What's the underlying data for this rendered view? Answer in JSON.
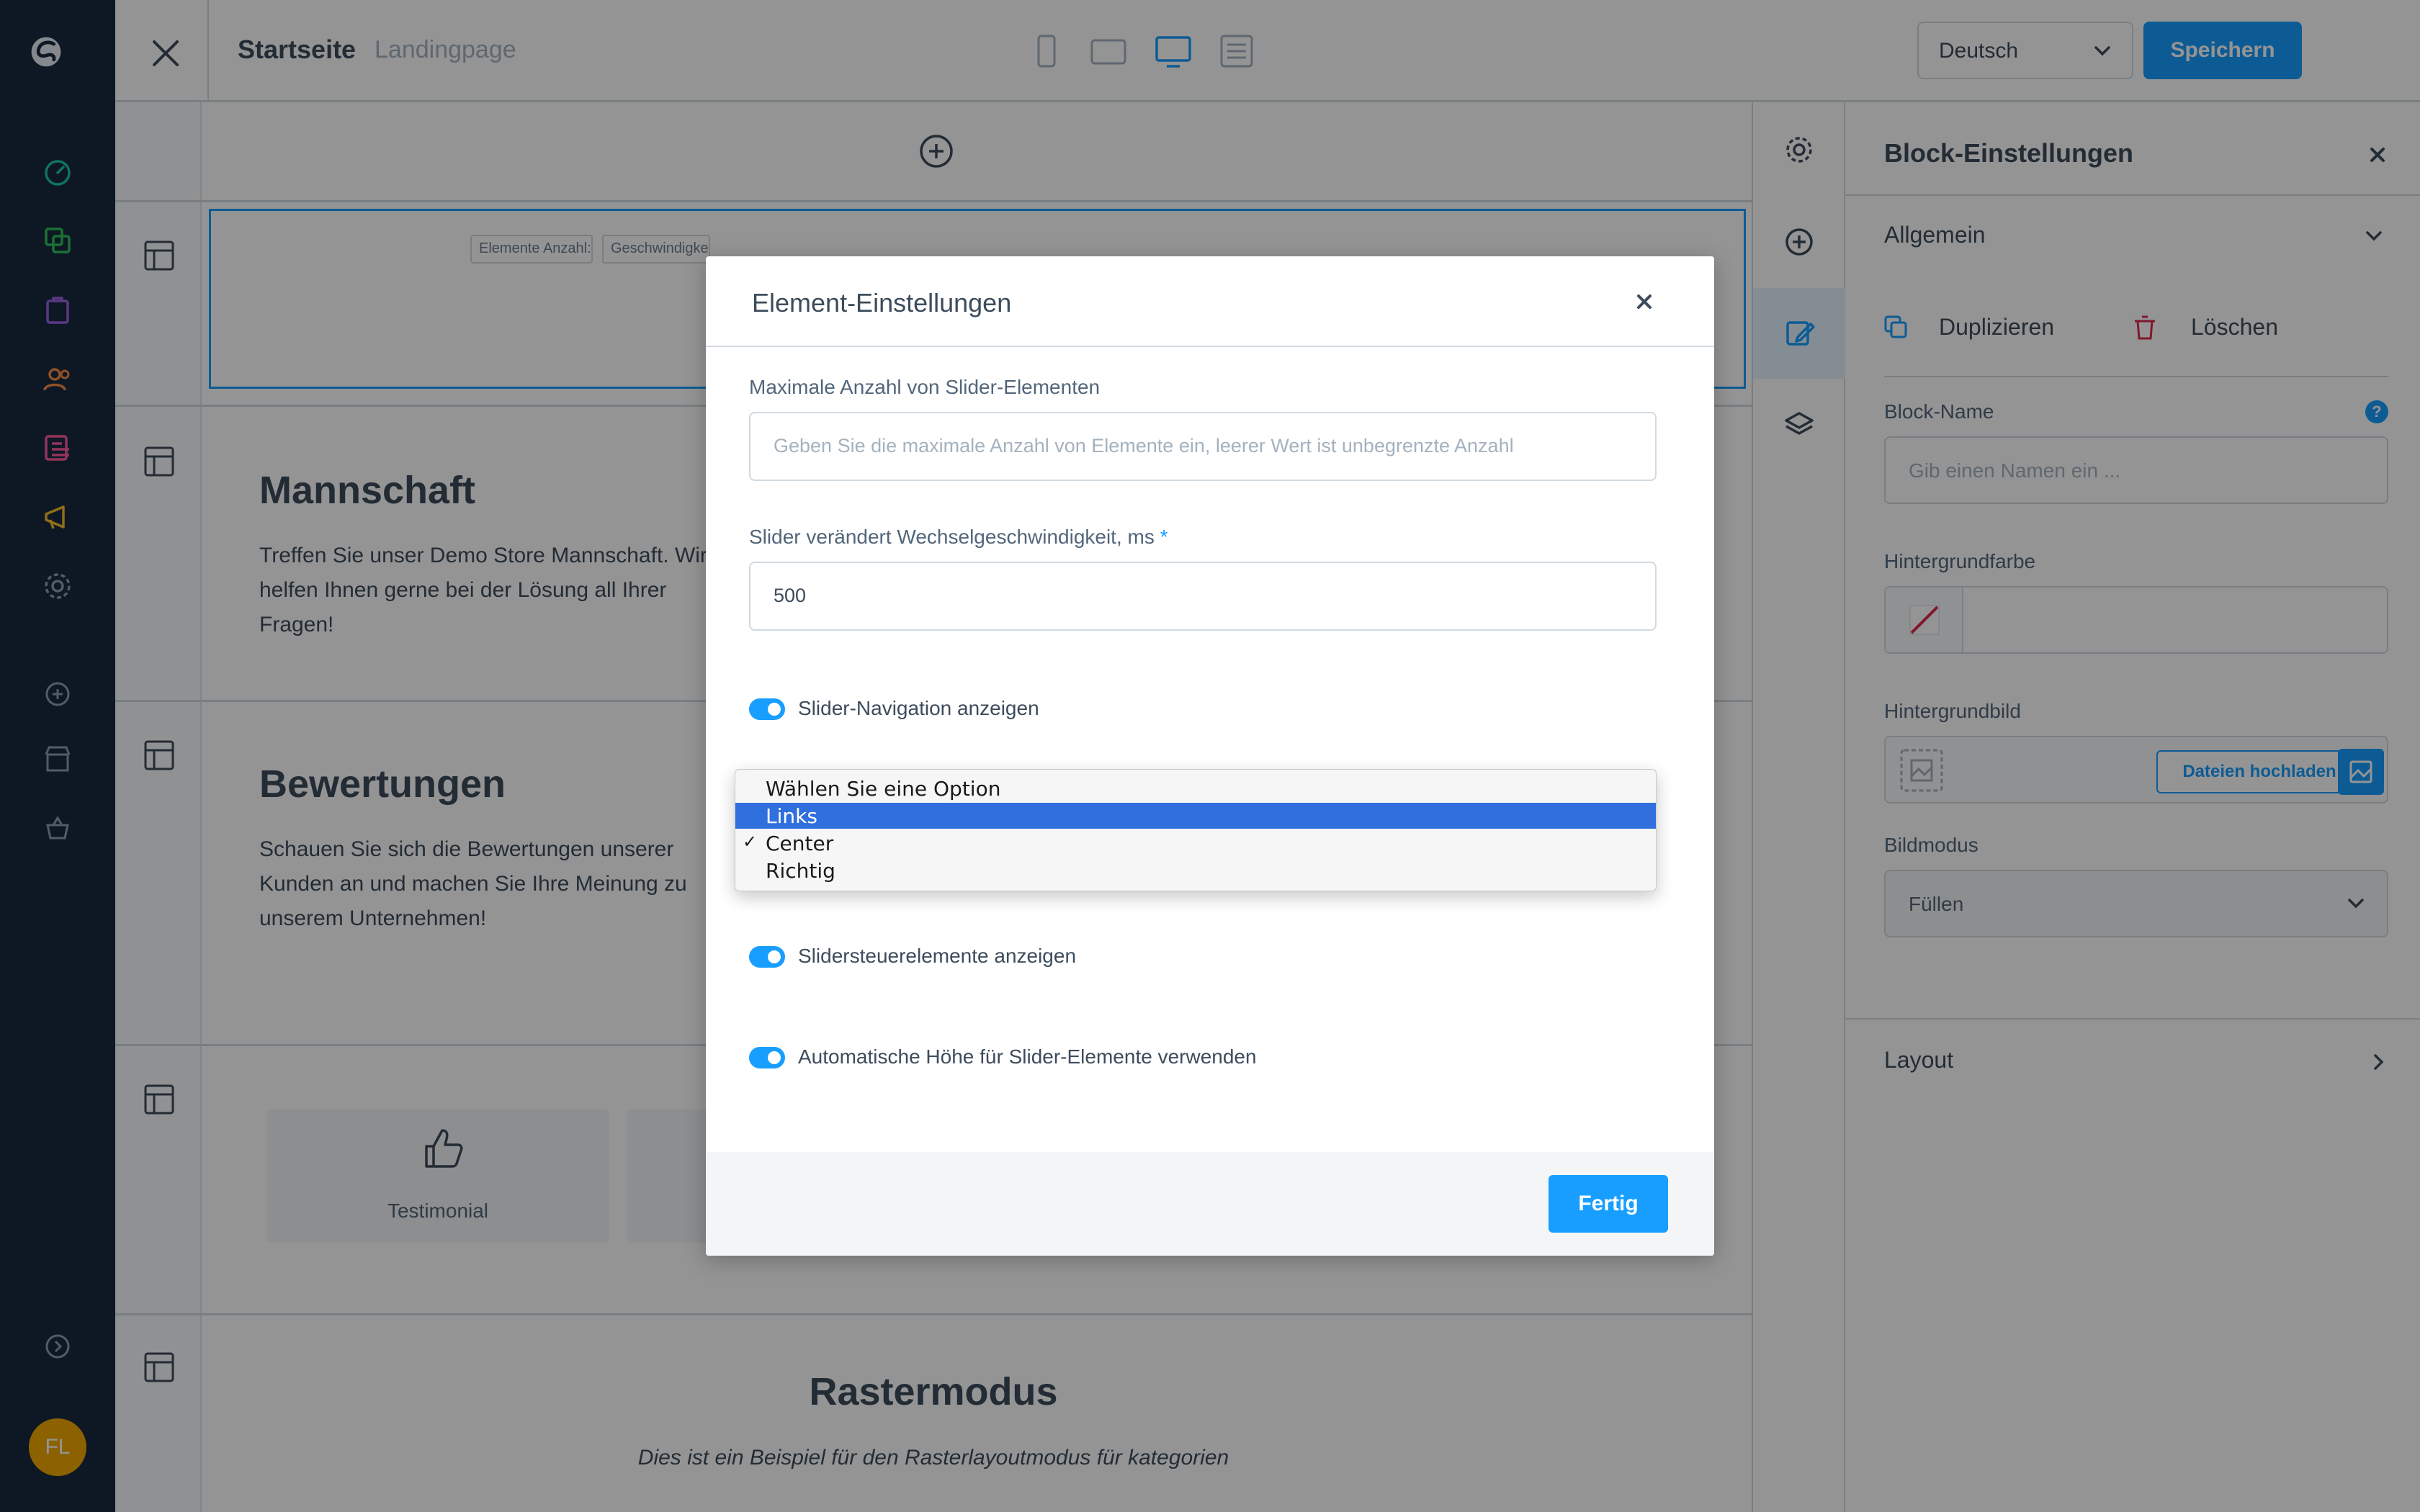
{
  "topbar": {
    "title": "Startseite",
    "subtitle": "Landingpage",
    "language": "Deutsch",
    "save_label": "Speichern"
  },
  "canvas": {
    "slider_chips": [
      "Elemente Anzahl:",
      "Geschwindigkeit"
    ],
    "blocks": [
      {
        "heading": "Mannschaft",
        "text": "Treffen Sie unser Demo Store Mannschaft. Wir helfen Ihnen gerne bei der Lösung all Ihrer Fragen!"
      },
      {
        "heading": "Bewertungen",
        "text": "Schauen Sie sich die Bewertungen unserer Kunden an und machen Sie Ihre Meinung zu unserem Unternehmen!"
      }
    ],
    "testimonial_label": "Testimonial",
    "raster_heading": "Rastermodus",
    "raster_text": "Dies ist ein Beispiel für den Rasterlayoutmodus für kategorien"
  },
  "block_panel": {
    "title": "Block-Einstellungen",
    "general": "Allgemein",
    "duplicate": "Duplizieren",
    "delete": "Löschen",
    "name_label": "Block-Name",
    "name_placeholder": "Gib einen Namen ein ...",
    "help": "?",
    "bg_color_label": "Hintergrundfarbe",
    "bg_image_label": "Hintergrundbild",
    "upload_label": "Dateien hochladen",
    "image_mode_label": "Bildmodus",
    "image_mode_value": "Füllen",
    "layout": "Layout"
  },
  "modal": {
    "title": "Element-Einstellungen",
    "max_label": "Maximale Anzahl von Slider-Elementen",
    "max_placeholder": "Geben Sie die maximale Anzahl von Elemente ein, leerer Wert ist unbegrenzte Anzahl",
    "speed_label": "Slider verändert Wechselgeschwindigkeit, ms",
    "speed_required": "*",
    "speed_value": "500",
    "nav_label": "Slider-Navigation anzeigen",
    "controls_label": "Slidersteuerelemente anzeigen",
    "autoheight_label": "Automatische Höhe für Slider-Elemente verwenden",
    "done_label": "Fertig",
    "dropdown": {
      "options": [
        "Wählen Sie eine Option",
        "Links",
        "Center",
        "Richtig"
      ],
      "highlighted": "Links",
      "selected": "Center",
      "check": "✓"
    }
  },
  "user": {
    "initials": "FL"
  },
  "colors": {
    "sidebar": "#172a3e",
    "accent": "#189eff",
    "highlight": "#2f6fde",
    "avatar": "#f2a900"
  }
}
